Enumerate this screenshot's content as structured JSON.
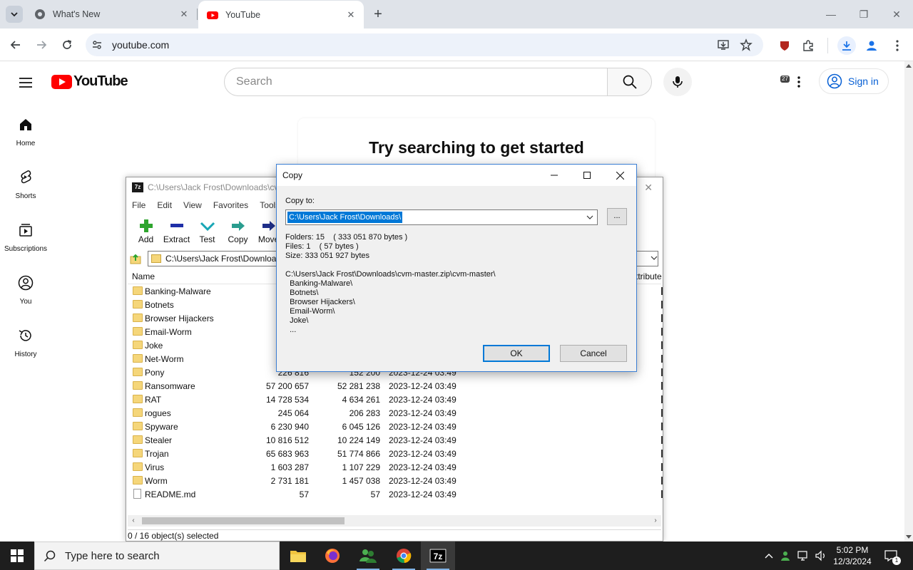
{
  "browser": {
    "tabs": [
      {
        "label": "What's New",
        "close": "✕"
      },
      {
        "label": "YouTube",
        "close": "✕"
      }
    ],
    "url": "youtube.com",
    "extension_badge": "27",
    "accent": "#1a73e8"
  },
  "youtube": {
    "logo_text": "YouTube",
    "search_placeholder": "Search",
    "sign_in": "Sign in",
    "empty_title": "Try searching to get started",
    "sidebar": [
      {
        "label": "Home",
        "icon": "home-icon"
      },
      {
        "label": "Shorts",
        "icon": "shorts-icon"
      },
      {
        "label": "Subscriptions",
        "icon": "subscriptions-icon"
      },
      {
        "label": "You",
        "icon": "you-icon"
      },
      {
        "label": "History",
        "icon": "history-icon"
      }
    ],
    "brand_color": "#ff0000"
  },
  "sevenzip": {
    "title": "C:\\Users\\Jack Frost\\Downloads\\cv",
    "menu": [
      "File",
      "Edit",
      "View",
      "Favorites",
      "Tools"
    ],
    "toolbar": [
      "Add",
      "Extract",
      "Test",
      "Copy",
      "Move"
    ],
    "address": "C:\\Users\\Jack Frost\\Downloa",
    "columns": {
      "name": "Name",
      "attributes": "ttribute"
    },
    "rows": [
      {
        "name": "Banking-Malware",
        "size": "4",
        "packed": "",
        "date": "",
        "type": "folder"
      },
      {
        "name": "Botnets",
        "size": "14!",
        "packed": "",
        "date": "",
        "type": "folder"
      },
      {
        "name": "Browser Hijackers",
        "size": "3",
        "packed": "",
        "date": "",
        "type": "folder"
      },
      {
        "name": "Email-Worm",
        "size": "3",
        "packed": "",
        "date": "",
        "type": "folder"
      },
      {
        "name": "Joke",
        "size": "14",
        "packed": "",
        "date": "",
        "type": "folder"
      },
      {
        "name": "Net-Worm",
        "size": "5",
        "packed": "",
        "date": "",
        "type": "folder"
      },
      {
        "name": "Pony",
        "size": "226 816",
        "packed": "152 200",
        "date": "2023-12-24 03:49",
        "type": "folder"
      },
      {
        "name": "Ransomware",
        "size": "57 200 657",
        "packed": "52 281 238",
        "date": "2023-12-24 03:49",
        "type": "folder"
      },
      {
        "name": "RAT",
        "size": "14 728 534",
        "packed": "4 634 261",
        "date": "2023-12-24 03:49",
        "type": "folder"
      },
      {
        "name": "rogues",
        "size": "245 064",
        "packed": "206 283",
        "date": "2023-12-24 03:49",
        "type": "folder"
      },
      {
        "name": "Spyware",
        "size": "6 230 940",
        "packed": "6 045 126",
        "date": "2023-12-24 03:49",
        "type": "folder"
      },
      {
        "name": "Stealer",
        "size": "10 816 512",
        "packed": "10 224 149",
        "date": "2023-12-24 03:49",
        "type": "folder"
      },
      {
        "name": "Trojan",
        "size": "65 683 963",
        "packed": "51 774 866",
        "date": "2023-12-24 03:49",
        "type": "folder"
      },
      {
        "name": "Virus",
        "size": "1 603 287",
        "packed": "1 107 229",
        "date": "2023-12-24 03:49",
        "type": "folder"
      },
      {
        "name": "Worm",
        "size": "2 731 181",
        "packed": "1 457 038",
        "date": "2023-12-24 03:49",
        "type": "folder"
      },
      {
        "name": "README.md",
        "size": "57",
        "packed": "57",
        "date": "2023-12-24 03:49",
        "type": "file"
      }
    ],
    "status": "0 / 16 object(s) selected"
  },
  "copy_dialog": {
    "title": "Copy",
    "label": "Copy to:",
    "destination": "C:\\Users\\Jack Frost\\Downloads\\",
    "browse": "...",
    "info": "Folders: 15    ( 333 051 870 bytes )\nFiles: 1    ( 57 bytes )\nSize: 333 051 927 bytes",
    "paths": "C:\\Users\\Jack Frost\\Downloads\\cvm-master.zip\\cvm-master\\\n  Banking-Malware\\\n  Botnets\\\n  Browser Hijackers\\\n  Email-Worm\\\n  Joke\\\n  ...",
    "ok": "OK",
    "cancel": "Cancel"
  },
  "taskbar": {
    "search_placeholder": "Type here to search",
    "time": "5:02 PM",
    "date": "12/3/2024",
    "notification_count": "1",
    "apps": [
      "file-explorer-icon",
      "firefox-icon",
      "people-icon",
      "chrome-icon",
      "7zip-icon"
    ]
  }
}
